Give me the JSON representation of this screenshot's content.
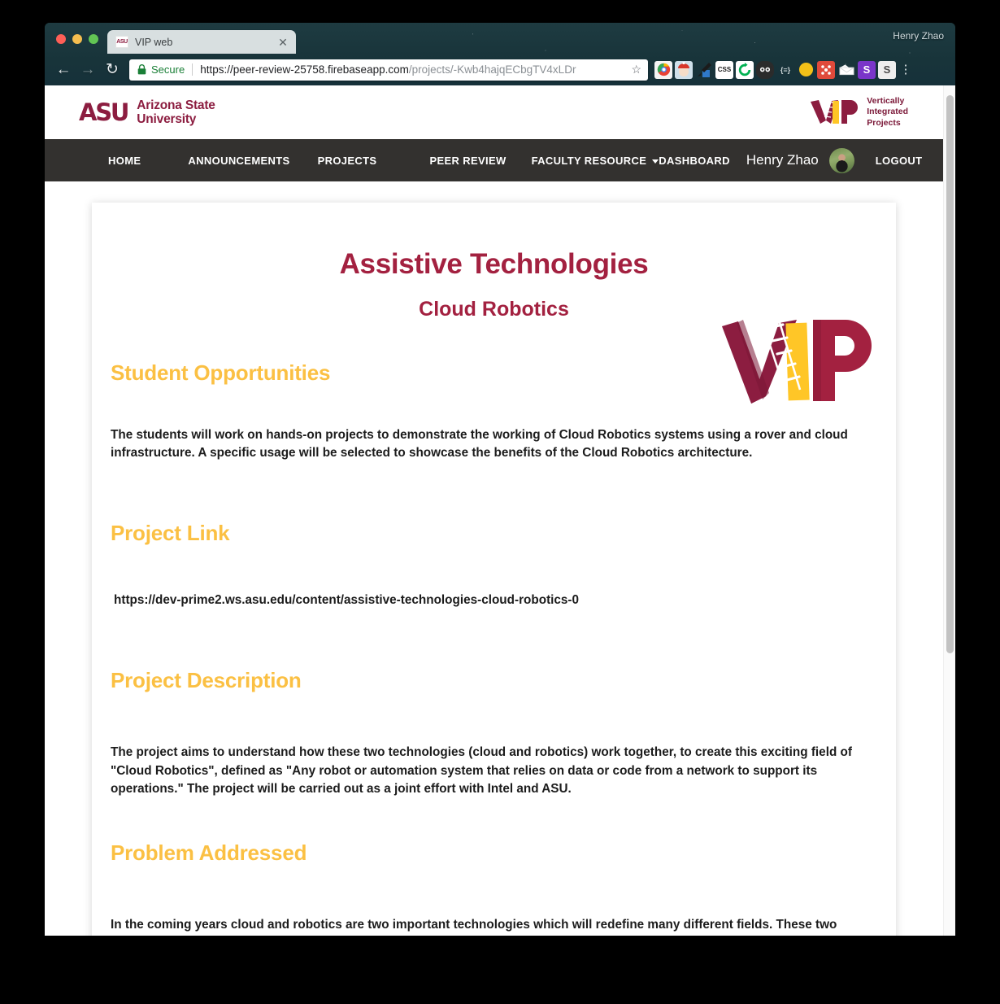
{
  "browser": {
    "profile_name": "Henry Zhao",
    "tab": {
      "title": "VIP web",
      "favicon_text": "ASU",
      "close_label": "✕"
    },
    "toolbar": {
      "back_label": "←",
      "forward_label": "→",
      "reload_label": "↻",
      "secure_label": "Secure",
      "url_main": "https://peer-review-25758.firebaseapp.com",
      "url_path": "/projects/-Kwb4hajqECbgTV4xLDr",
      "star_label": "☆",
      "menu_label": "⋮"
    },
    "extensions": [
      {
        "name": "chrome-colorwheel-extension-icon",
        "glyph": "◉",
        "bg": "#f4f4f4",
        "fg": "#2b7de9"
      },
      {
        "name": "santa-avatar-extension-icon",
        "glyph": "☺",
        "bg": "#d8e3ea",
        "fg": "#c0392b"
      },
      {
        "name": "eyedropper-extension-icon",
        "glyph": "✎",
        "bg": "#2f79c9",
        "fg": "#ffffff"
      },
      {
        "name": "css-pencil-extension-icon",
        "glyph": "CSS",
        "bg": "#ffffff",
        "fg": "#1b1b1b"
      },
      {
        "name": "refresh-circle-extension-icon",
        "glyph": "↻",
        "bg": "#ffffff",
        "fg": "#00b152"
      },
      {
        "name": "goggles-extension-icon",
        "glyph": "●●",
        "bg": "#2b2b2b",
        "fg": "#ffffff"
      },
      {
        "name": "json-brackets-extension-icon",
        "glyph": "{≡}",
        "bg": "transparent",
        "fg": "#cfd8da"
      },
      {
        "name": "moon-extension-icon",
        "glyph": "◐",
        "bg": "#ffffff",
        "fg": "#f2b705"
      },
      {
        "name": "red-grid-extension-icon",
        "glyph": "⌘",
        "bg": "#e04a3b",
        "fg": "#ffffff"
      },
      {
        "name": "envelope-extension-icon",
        "glyph": "✉",
        "bg": "#e9eef0",
        "fg": "#8a8f94"
      },
      {
        "name": "purple-s-extension-icon",
        "glyph": "S",
        "bg": "#7a35c9",
        "fg": "#ffffff"
      },
      {
        "name": "grey-s-extension-icon",
        "glyph": "S",
        "bg": "#eeeeee",
        "fg": "#4a4a4a"
      }
    ]
  },
  "masthead": {
    "asu_mark": "ASU",
    "asu_line1": "Arizona State",
    "asu_line2": "University",
    "vip_mark": "VIP",
    "vip_line1": "Vertically",
    "vip_line2": "Integrated",
    "vip_line3": "Projects"
  },
  "nav": {
    "items": [
      {
        "label": "HOME",
        "has_caret": false
      },
      {
        "label": "ANNOUNCEMENTS",
        "has_caret": false
      },
      {
        "label": "PROJECTS",
        "has_caret": false
      },
      {
        "label": "PEER REVIEW",
        "has_caret": false
      },
      {
        "label": "FACULTY RESOURCE",
        "has_caret": true
      }
    ],
    "dashboard": "DASHBOARD",
    "user": "Henry Zhao",
    "logout": "LOGOUT"
  },
  "project": {
    "title": "Assistive Technologies",
    "subtitle": "Cloud Robotics",
    "sections": [
      {
        "heading": "Student Opportunities",
        "body": "The students will work on hands-on projects to demonstrate the working of Cloud Robotics systems using a rover and cloud infrastructure. A specific usage will be selected to showcase the benefits of the Cloud Robotics architecture."
      },
      {
        "heading": "Project Link",
        "body": "https://dev-prime2.ws.asu.edu/content/assistive-technologies-cloud-robotics-0"
      },
      {
        "heading": "Project Description",
        "body": "The project aims to understand how these two technologies (cloud and robotics) work together, to create this exciting field of \"Cloud Robotics\", defined as \"Any robot or automation system that relies on data or code from a network to support its operations.\" The project will be carried out as a joint effort with Intel and ASU."
      },
      {
        "heading": "Problem Addressed",
        "body": "In the coming years cloud and robotics are two important technologies which will redefine many different fields. These two technologies together with advances in artificial intelligence will enable usages such as self-driving cars, industrial automation, home assistants, construction using drones, and other advances."
      }
    ]
  },
  "colors": {
    "asu_maroon": "#8c1d40",
    "title_maroon": "#a32140",
    "gold": "#fbc043",
    "navbar": "#33312f"
  }
}
